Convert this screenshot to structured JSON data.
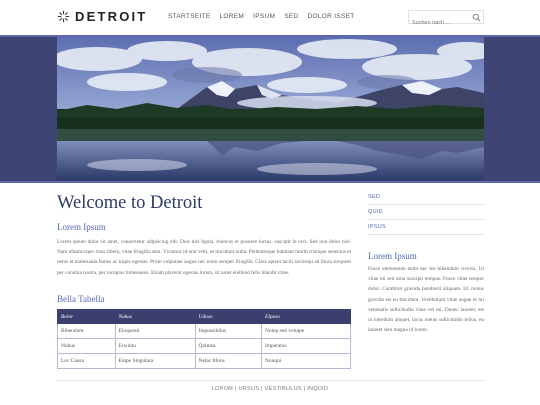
{
  "header": {
    "logo_text": "DETROIT",
    "logo_icon": "sun-rays-icon",
    "nav": [
      "STARTSEITE",
      "LOREM",
      "IPSUM",
      "SED",
      "DOLOR ISSET"
    ],
    "search": {
      "placeholder": "Suchen nach ...",
      "icon": "search-icon"
    }
  },
  "banner": {
    "alt": "Mountain lake landscape"
  },
  "main": {
    "title": "Welcome to Detroit",
    "section1_title": "Lorem Ipsum",
    "paragraph1": "Lorem ipsum dolor sit amet, consectetur adipiscing elit. Duis nisl ligula, rhoncus et posuere luctus, suscipit in orci. Sed non dolor nisl. Nam ullamcorper risus libero, vitae fringilla sem. Vivamus id erat velit, ut tincidunt nulla. Pellentesque habitant morbi tristique senectus et netus et malesuada fames ac turpis egestas. Proin vulputate augue nec enim semper fringilla. Class aptent taciti sociosqu ad litora torquent per conubia nostra, per inceptos himenaeos. Etiam placerat egestas lorem, sit amet eleifend felis blandit vitae.",
    "section2_title": "Bella Tabella",
    "table": {
      "headers": [
        "Bolor",
        "Nukus",
        "Udoso",
        "Elpaso"
      ],
      "rows": [
        [
          "Bibendum",
          "Eloquenti",
          "Impossibilus",
          "Nolep sed volutpe"
        ],
        [
          "Nukus",
          "Erwintu",
          "Quintus",
          "Imperatus"
        ],
        [
          "Loc Causa",
          "Empe Singulara",
          "Nelac Ithios",
          "Nunqui"
        ]
      ]
    }
  },
  "sidebar": {
    "links": [
      "SED",
      "QUID",
      "IPSUS"
    ],
    "title": "Lorem Ipsum",
    "paragraph": "Fusce elementum enim nec leo bibendum viverra. Ut vitae mi sed urna suscipit tempus. Fusce vitae tempor dolor. Curabitur gravida hendrerit aliquam. Ut cursus gravida est eu tincidunt. Vestibulum vitae augue et mi venenatis sollicitudin vitae vel mi. Donec laoreet, est ut interdum aliquet, lacus metus sollicitudin tellus, eu laoreet sem magna id lorem."
  },
  "footer": {
    "links": [
      "LOPOM",
      "URSUS",
      "VESTIBULUS",
      "INQUID"
    ],
    "separator": " | "
  },
  "colors": {
    "accent": "#5468b8",
    "dark_navy": "#2e3b66",
    "band": "#3e4474",
    "table_header": "#3a3f6d"
  }
}
